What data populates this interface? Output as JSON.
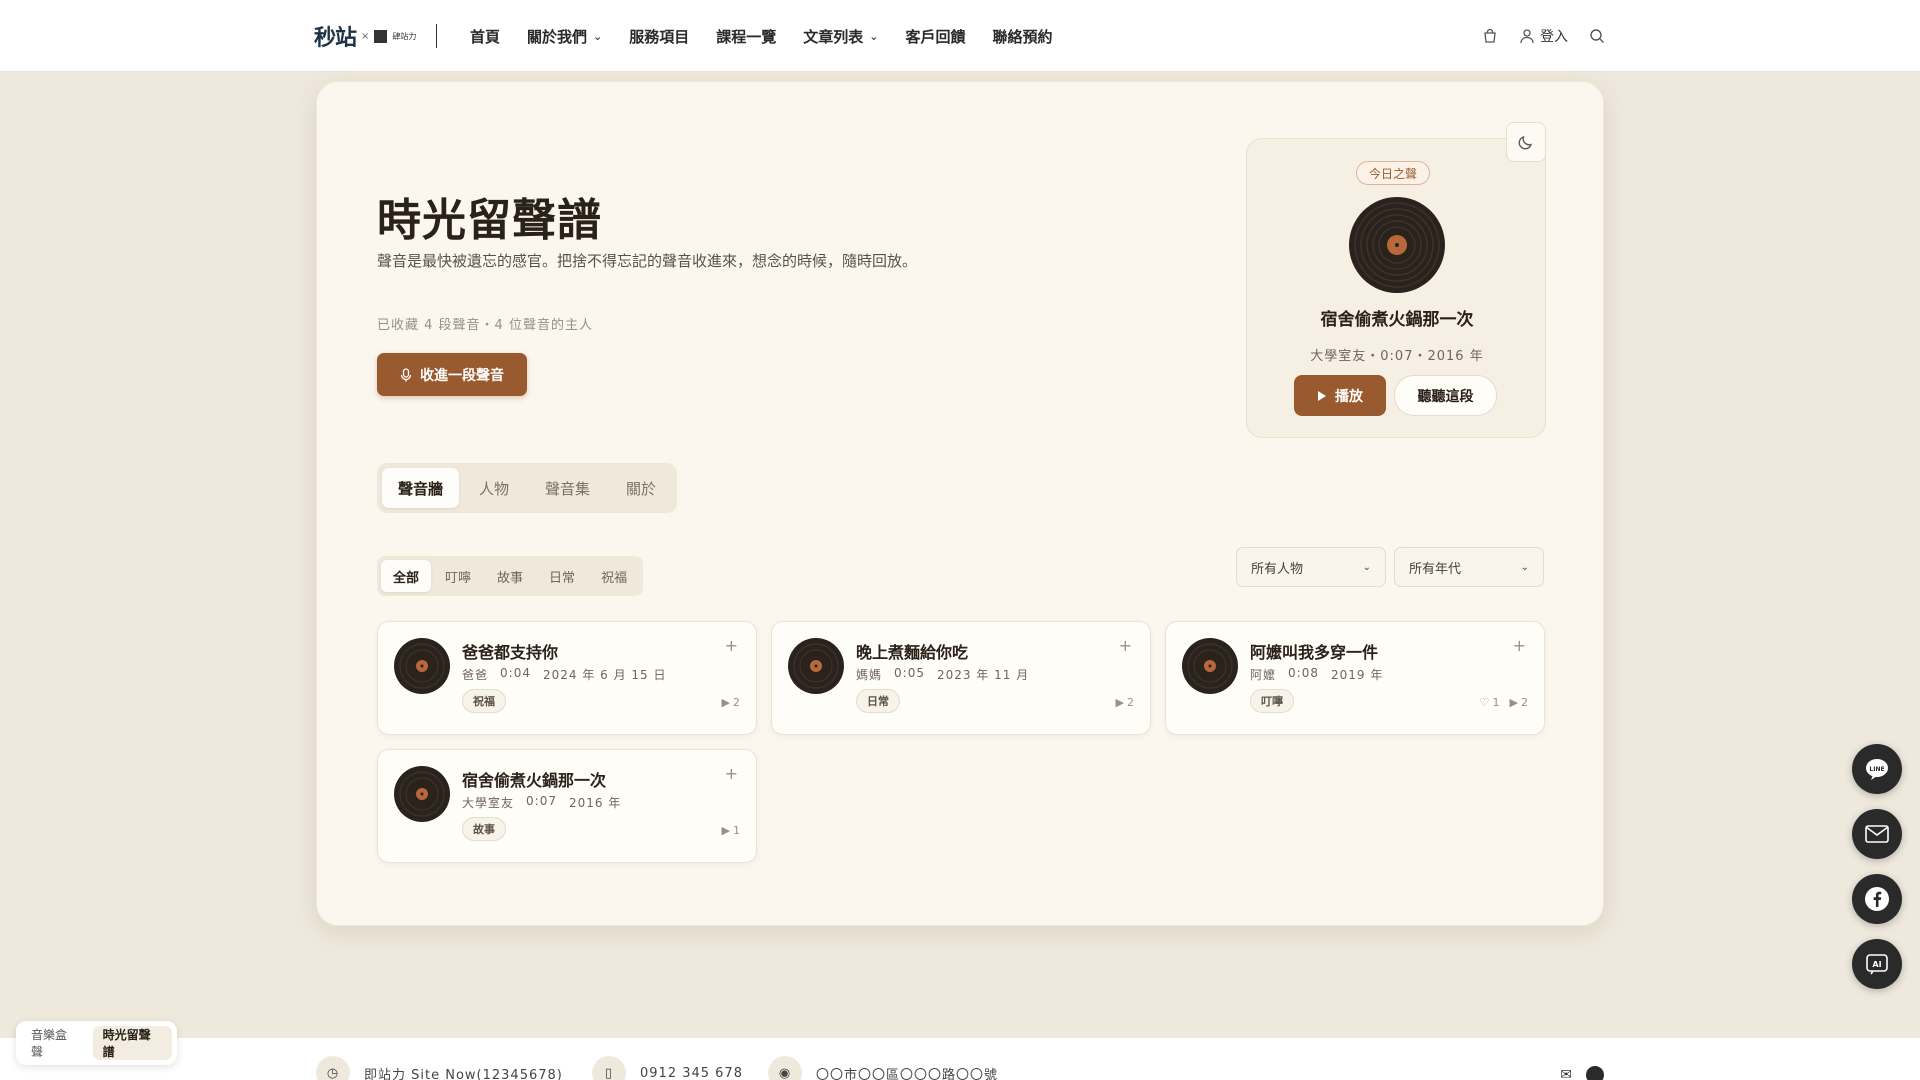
{
  "header": {
    "logo_main": "秒站",
    "logo_x": "×",
    "logo_sub": "肆站力",
    "nav": [
      {
        "label": "首頁",
        "dropdown": false
      },
      {
        "label": "關於我們",
        "dropdown": true
      },
      {
        "label": "服務項目",
        "dropdown": false
      },
      {
        "label": "課程一覽",
        "dropdown": false
      },
      {
        "label": "文章列表",
        "dropdown": true
      },
      {
        "label": "客戶回饋",
        "dropdown": false
      },
      {
        "label": "聯絡預約",
        "dropdown": false
      }
    ],
    "login_label": "登入"
  },
  "hero": {
    "title": "時光留聲譜",
    "desc": "聲音是最快被遺忘的感官。把捨不得忘記的聲音收進來，想念的時候，隨時回放。",
    "stats": "已收藏 4 段聲音・4 位聲音的主人",
    "record_label": "收進一段聲音"
  },
  "today": {
    "badge": "今日之聲",
    "title": "宿舍偷煮火鍋那一次",
    "meta": "大學室友・0:07・2016 年",
    "play_label": "播放",
    "listen_label": "聽聽這段"
  },
  "main_tabs": [
    "聲音牆",
    "人物",
    "聲音集",
    "關於"
  ],
  "filter_tabs": [
    "全部",
    "叮嚀",
    "故事",
    "日常",
    "祝福"
  ],
  "selects": {
    "person": "所有人物",
    "year": "所有年代"
  },
  "cards": [
    {
      "title": "爸爸都支持你",
      "person": "爸爸",
      "duration": "0:04",
      "date": "2024 年 6 月 15 日",
      "tag": "祝福",
      "likes": "",
      "plays": "2"
    },
    {
      "title": "晚上煮麵給你吃",
      "person": "媽媽",
      "duration": "0:05",
      "date": "2023 年 11 月",
      "tag": "日常",
      "likes": "",
      "plays": "2"
    },
    {
      "title": "阿嬤叫我多穿一件",
      "person": "阿嬤",
      "duration": "0:08",
      "date": "2019 年",
      "tag": "叮嚀",
      "likes": "1",
      "plays": "2"
    },
    {
      "title": "宿舍偷煮火鍋那一次",
      "person": "大學室友",
      "duration": "0:07",
      "date": "2016 年",
      "tag": "故事",
      "likes": "",
      "plays": "1"
    }
  ],
  "switcher": [
    "音樂盒聲",
    "時光留聲譜"
  ],
  "footer": {
    "company": "即站力 Site Now(12345678)",
    "phone": "0912 345 678",
    "address": "〇〇市〇〇區〇〇〇路〇〇號"
  },
  "colors": {
    "accent": "#9a5a2f",
    "background": "#efe9dd",
    "card": "#fbf7ef"
  }
}
